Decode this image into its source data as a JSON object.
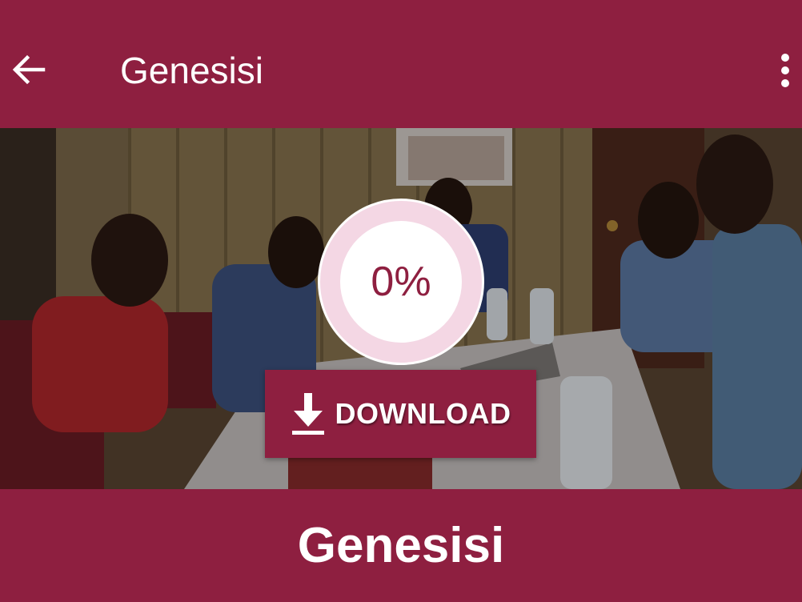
{
  "appbar": {
    "title": "Genesisi",
    "back_icon": "arrow-left-icon",
    "menu_icon": "more-vertical-icon"
  },
  "hero": {
    "progress_text": "0%",
    "download_label": "DOWNLOAD",
    "download_icon": "download-icon"
  },
  "footer": {
    "title": "Genesisi"
  },
  "colors": {
    "primary": "#8e1f40",
    "ring": "#f4d7e4",
    "text_on_primary": "#ffffff"
  }
}
